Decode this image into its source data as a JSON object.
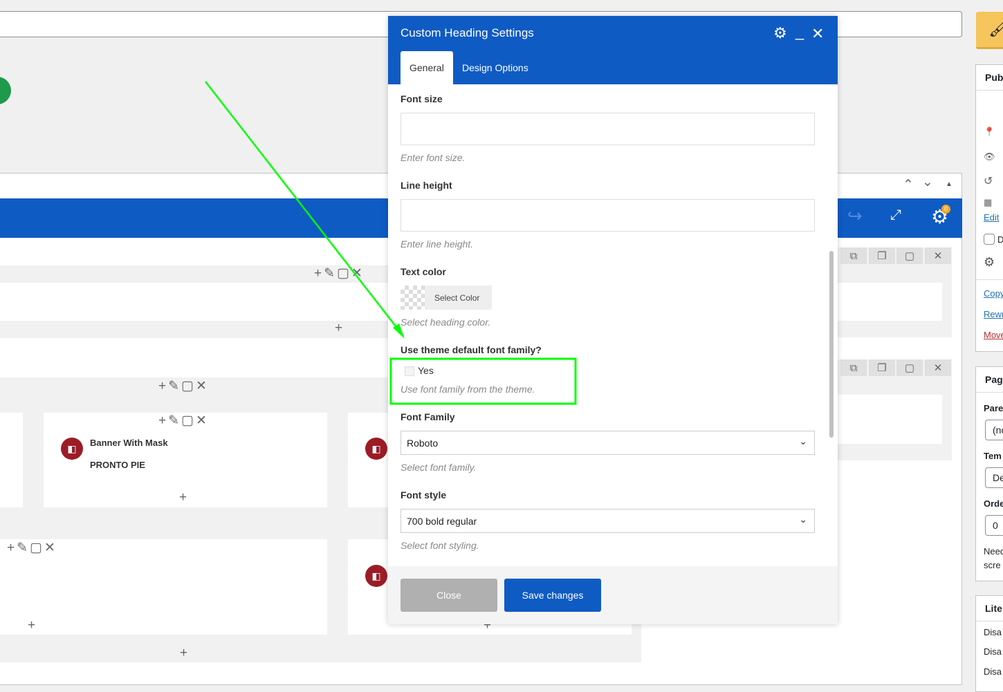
{
  "modal": {
    "title": "Custom Heading Settings",
    "tabs": [
      {
        "label": "General",
        "active": true
      },
      {
        "label": "Design Options",
        "active": false
      }
    ],
    "fields": {
      "font_size": {
        "label": "Font size",
        "value": "",
        "hint": "Enter font size."
      },
      "line_height": {
        "label": "Line height",
        "value": "",
        "hint": "Enter line height."
      },
      "text_color": {
        "label": "Text color",
        "button": "Select Color",
        "hint": "Select heading color."
      },
      "theme_font": {
        "label": "Use theme default font family?",
        "option": "Yes",
        "checked": false,
        "hint": "Use font family from the theme."
      },
      "font_family": {
        "label": "Font Family",
        "value": "Roboto",
        "hint": "Select font family."
      },
      "font_style": {
        "label": "Font style",
        "value": "700 bold regular",
        "hint": "Select font styling."
      }
    },
    "footer": {
      "close": "Close",
      "save": "Save changes"
    }
  },
  "builder": {
    "elements": [
      {
        "title": "Banner With Mask",
        "subtitle": "PRONTO PIE"
      }
    ],
    "settings_badge": "0"
  },
  "sidebar": {
    "publish_heading": "Pub",
    "edit_link": "Edit",
    "checkbox_label": "D",
    "links": [
      {
        "text": "Copy",
        "color": "#2271b1"
      },
      {
        "text": "Rewr",
        "color": "#2271b1"
      },
      {
        "text": "Move",
        "color": "#b32d2e"
      }
    ],
    "page_heading": "Pag",
    "parent_label": "Pare",
    "parent_value": "(no",
    "template_label": "Tem",
    "template_value": "De",
    "order_label": "Orde",
    "order_value": "0",
    "help_text": [
      "Need",
      "scre"
    ],
    "lite_heading": "Lite",
    "lite_items": [
      "Disa",
      "Disa",
      "Disa"
    ]
  },
  "colors": {
    "accent": "#0f5bc4",
    "annotation": "#00ff00",
    "brand_orange": "#f6c55c"
  }
}
